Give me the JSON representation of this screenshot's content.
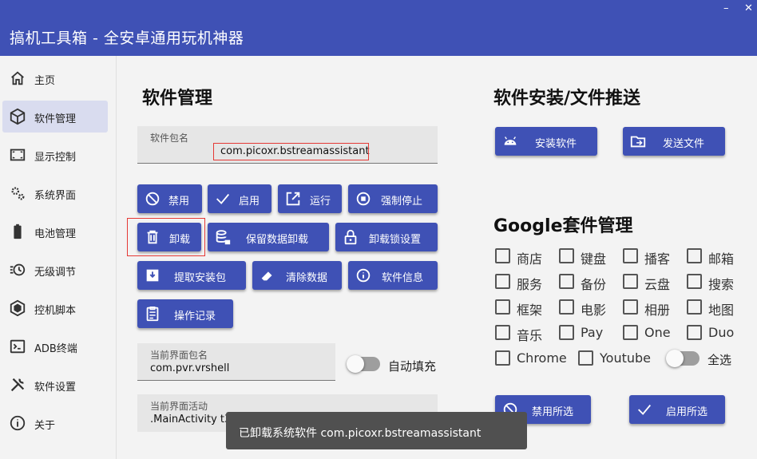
{
  "window": {
    "title": "搞机工具箱 - 全安卓通用玩机神器",
    "minimize": "–",
    "close": "✕"
  },
  "sidebar": {
    "items": [
      {
        "label": "主页",
        "icon": "home-icon"
      },
      {
        "label": "软件管理",
        "icon": "package-icon"
      },
      {
        "label": "显示控制",
        "icon": "screen-icon"
      },
      {
        "label": "系统界面",
        "icon": "gears-icon"
      },
      {
        "label": "电池管理",
        "icon": "battery-icon"
      },
      {
        "label": "无级调节",
        "icon": "timer-icon"
      },
      {
        "label": "控机脚本",
        "icon": "hexagon-icon"
      },
      {
        "label": "ADB终端",
        "icon": "terminal-icon"
      },
      {
        "label": "软件设置",
        "icon": "tools-icon"
      },
      {
        "label": "关于",
        "icon": "info-icon"
      }
    ]
  },
  "app_manage": {
    "heading": "软件管理",
    "package_label": "软件包名",
    "package_value": "com.picoxr.bstreamassistant",
    "buttons": {
      "disable": "禁用",
      "enable": "启用",
      "run": "运行",
      "force_stop": "强制停止",
      "uninstall": "卸载",
      "keep_data_uninstall": "保留数据卸载",
      "uninstall_lock": "卸载锁设置",
      "extract_apk": "提取安装包",
      "clear_data": "清除数据",
      "app_info": "软件信息",
      "op_log": "操作记录"
    },
    "current_package_label": "当前界面包名",
    "current_package_value": "com.pvr.vrshell",
    "auto_fill_label": "自动填充",
    "current_activity_label": "当前界面活动",
    "current_activity_value": ".MainActivity t3"
  },
  "install_push": {
    "heading": "软件安装/文件推送",
    "install_button": "安装软件",
    "push_button": "发送文件"
  },
  "google": {
    "heading": "Google套件管理",
    "checkboxes": [
      "商店",
      "键盘",
      "播客",
      "邮箱",
      "服务",
      "备份",
      "云盘",
      "搜索",
      "框架",
      "电影",
      "相册",
      "地图",
      "音乐",
      "Pay",
      "One",
      "Duo",
      "Chrome",
      "Youtube"
    ],
    "select_all_label": "全选",
    "disable_selected": "禁用所选",
    "enable_selected": "启用所选"
  },
  "toast": {
    "message": "已卸载系统软件 com.picoxr.bstreamassistant"
  },
  "colors": {
    "accent": "#3f51b5",
    "active_nav": "#d9dcef",
    "highlight": "#e53935"
  }
}
